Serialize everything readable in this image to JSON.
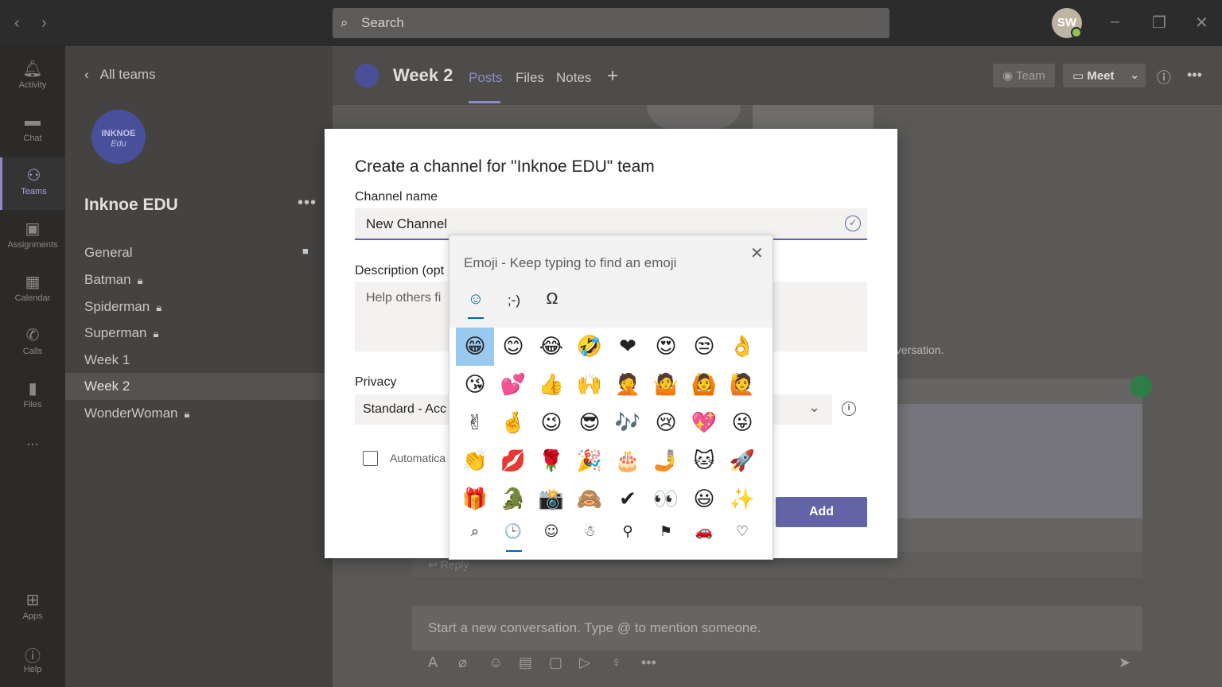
{
  "titlebar": {
    "search_placeholder": "Search",
    "avatar_initials": "SW"
  },
  "rail": {
    "items": [
      {
        "label": "Activity",
        "icon": "bell-icon"
      },
      {
        "label": "Chat",
        "icon": "chat-icon"
      },
      {
        "label": "Teams",
        "icon": "teams-icon"
      },
      {
        "label": "Assignments",
        "icon": "assignments-icon"
      },
      {
        "label": "Calendar",
        "icon": "calendar-icon"
      },
      {
        "label": "Calls",
        "icon": "phone-icon"
      },
      {
        "label": "Files",
        "icon": "file-icon"
      },
      {
        "label": "...",
        "icon": "more-icon"
      },
      {
        "label": "Apps",
        "icon": "apps-icon"
      },
      {
        "label": "Help",
        "icon": "help-icon"
      }
    ]
  },
  "teampanel": {
    "all_teams": "All teams",
    "logo_line1": "INKNOE",
    "logo_line2": "Edu",
    "team_name": "Inknoe EDU",
    "more": "•••",
    "channels": [
      {
        "name": "General",
        "locked": false
      },
      {
        "name": "Batman",
        "locked": true
      },
      {
        "name": "Spiderman",
        "locked": true
      },
      {
        "name": "Superman",
        "locked": true
      },
      {
        "name": "Week 1",
        "locked": false
      },
      {
        "name": "Week 2",
        "locked": false,
        "selected": true
      },
      {
        "name": "WonderWoman",
        "locked": true
      }
    ]
  },
  "channel_header": {
    "title": "Week 2",
    "tabs": [
      "Posts",
      "Files",
      "Notes"
    ],
    "add_tab": "+",
    "team_btn": "Team",
    "meet_btn": "Meet"
  },
  "feed": {
    "conversation_fragment": "nversation.",
    "reply": "Reply",
    "compose_placeholder": "Start a new conversation. Type @ to mention someone."
  },
  "dialog": {
    "title": "Create a channel for \"Inknoe EDU\" team",
    "name_label": "Channel name",
    "name_value": "New Channel",
    "desc_label": "Description (opt",
    "desc_placeholder": "Help others fi",
    "privacy_label": "Privacy",
    "privacy_value": "Standard - Acc",
    "auto_label": "Automatica",
    "add_button": "Add"
  },
  "emoji_picker": {
    "title": "Emoji - Keep typing to find an emoji",
    "tabs": [
      {
        "glyph": "☺",
        "name": "emoji-tab"
      },
      {
        "glyph": ";-)",
        "name": "kaomoji-tab"
      },
      {
        "glyph": "Ω",
        "name": "symbols-tab"
      }
    ],
    "emojis": [
      "😁",
      "😊",
      "😂",
      "🤣",
      "❤",
      "😍",
      "😒",
      "👌",
      "😘",
      "💕",
      "👍",
      "🙌",
      "🤦",
      "🤷",
      "🙆",
      "🙋",
      "✌",
      "🤞",
      "😉",
      "😎",
      "🎶",
      "😢",
      "💖",
      "😜",
      "👏",
      "💋",
      "🌹",
      "🎉",
      "🎂",
      "🤳",
      "🐱",
      "🚀",
      "🎁",
      "🐊",
      "📸",
      "🙈",
      "✔",
      "👀",
      "😃",
      "✨"
    ],
    "categories": [
      "⌕",
      "🕒",
      "☺",
      "☃",
      "⚲",
      "⚑",
      "🚗",
      "♡"
    ]
  }
}
